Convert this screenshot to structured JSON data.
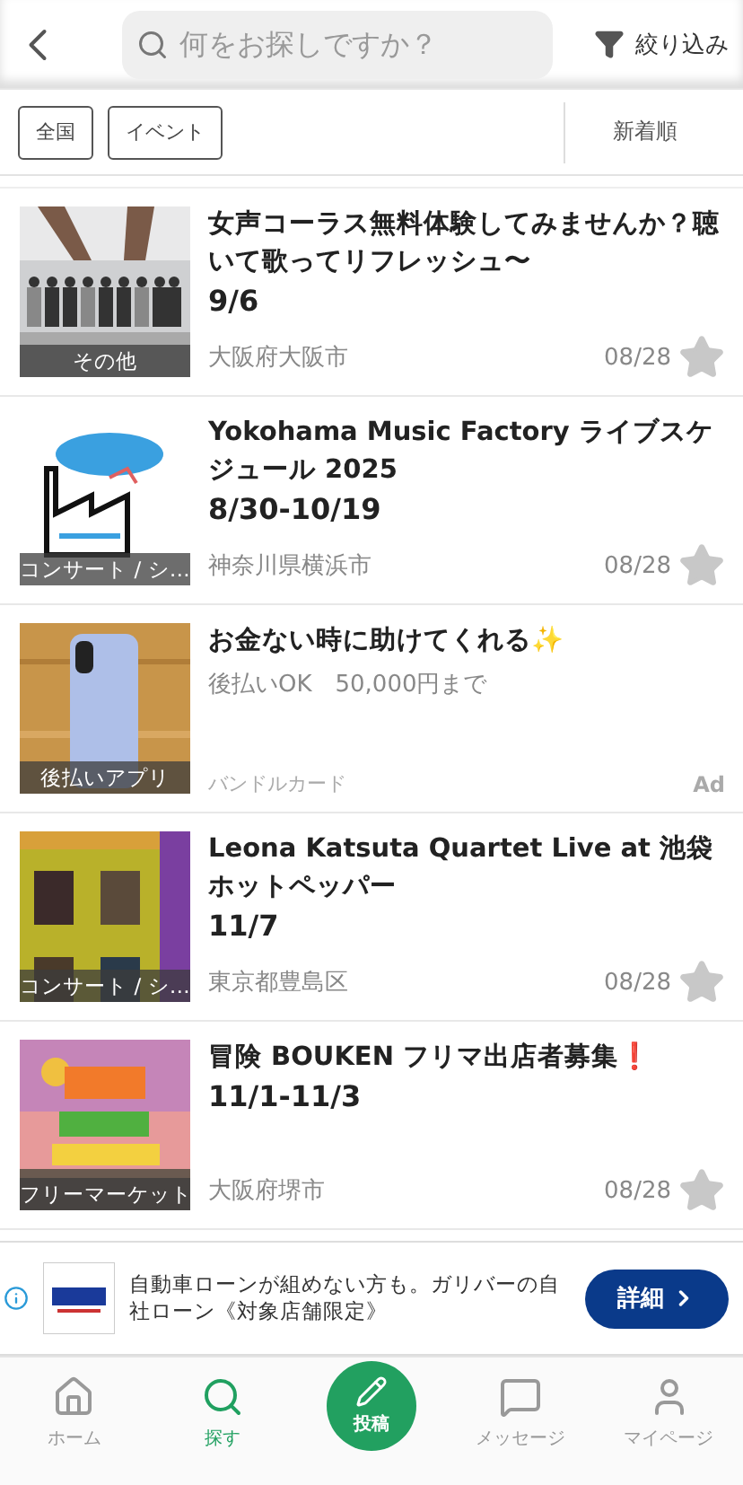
{
  "header": {
    "search": {
      "placeholder": "何をお探しですか？"
    },
    "filter_label": "絞り込み"
  },
  "chips": [
    {
      "label": "全国"
    },
    {
      "label": "イベント"
    }
  ],
  "sort_label": "新着順",
  "items": [
    {
      "kind": "event",
      "tag": "その他",
      "title": "女声コーラス無料体験してみませんか？聴いて歌ってリフレッシュ〜",
      "date": "9/6",
      "location": "大阪府大阪市",
      "posted": "08/28",
      "favorited": false
    },
    {
      "kind": "event",
      "tag": "コンサート / シ…",
      "title": "Yokohama Music Factory ライブスケジュール 2025",
      "date": "8/30-10/19",
      "location": "神奈川県横浜市",
      "posted": "08/28",
      "favorited": false
    },
    {
      "kind": "ad",
      "tag": "後払いアプリ",
      "title": "お金ない時に助けてくれる✨",
      "subtitle": "後払いOK　50,000円まで",
      "advertiser": "バンドルカード",
      "badge": "Ad"
    },
    {
      "kind": "event",
      "tag": "コンサート / シ…",
      "title": "Leona Katsuta Quartet Live at 池袋ホットペッパー",
      "date": "11/7",
      "location": "東京都豊島区",
      "posted": "08/28",
      "favorited": false
    },
    {
      "kind": "event",
      "tag": "フリーマーケット",
      "title": "冒険 BOUKEN フリマ出店者募集❗",
      "date": "11/1-11/3",
      "location": "大阪府堺市",
      "posted": "08/28",
      "favorited": false
    }
  ],
  "banner": {
    "text": "自動車ローンが組めない方も。ガリバーの自社ローン《対象店舗限定》",
    "button": "詳細"
  },
  "tabs": [
    {
      "label": "ホーム",
      "selected": false
    },
    {
      "label": "探す",
      "selected": true
    },
    {
      "label": "投稿",
      "selected": false
    },
    {
      "label": "メッセージ",
      "selected": false
    },
    {
      "label": "マイページ",
      "selected": false
    }
  ]
}
